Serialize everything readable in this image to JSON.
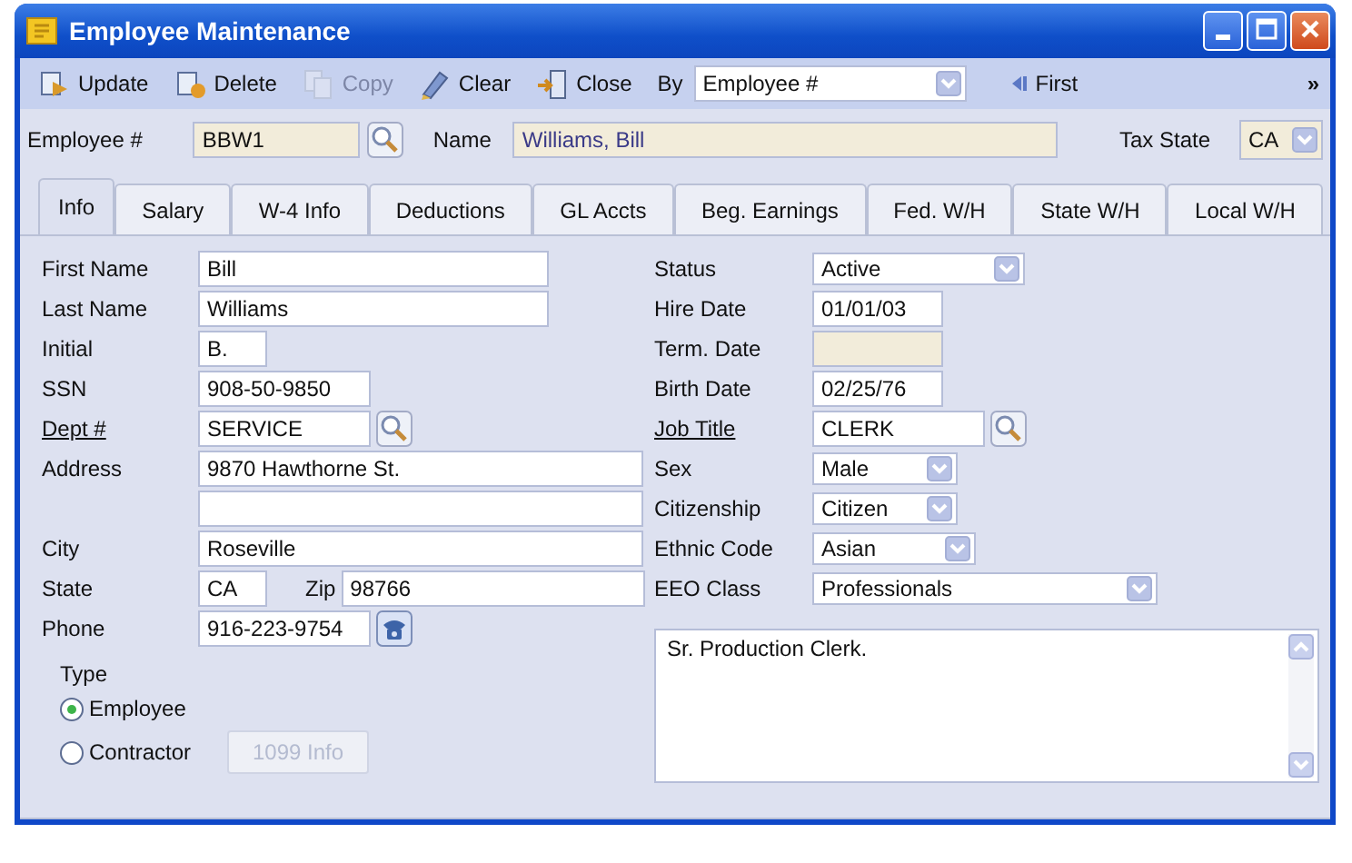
{
  "window": {
    "title": "Employee Maintenance"
  },
  "toolbar": {
    "buttons": [
      {
        "label": "Update",
        "disabled": false
      },
      {
        "label": "Delete",
        "disabled": false
      },
      {
        "label": "Copy",
        "disabled": true
      },
      {
        "label": "Clear",
        "disabled": false
      },
      {
        "label": "Close",
        "disabled": false
      }
    ],
    "by_label": "By",
    "by_value": "Employee #",
    "first": "First",
    "overflow": "»"
  },
  "header": {
    "employee_label": "Employee #",
    "employee_value": "BBW1",
    "name_label": "Name",
    "name_value": "Williams, Bill",
    "tax_state_label": "Tax State",
    "tax_state_value": "CA"
  },
  "tabs": [
    {
      "label": "Info",
      "selected": true
    },
    {
      "label": "Salary",
      "selected": false
    },
    {
      "label": "W-4 Info",
      "selected": false
    },
    {
      "label": "Deductions",
      "selected": false
    },
    {
      "label": "GL Accts",
      "selected": false
    },
    {
      "label": "Beg. Earnings",
      "selected": false
    },
    {
      "label": "Fed. W/H",
      "selected": false
    },
    {
      "label": "State W/H",
      "selected": false
    },
    {
      "label": "Local W/H",
      "selected": false
    }
  ],
  "left_fields": [
    {
      "kind": "text",
      "label": "First Name",
      "value": "Bill"
    },
    {
      "kind": "text",
      "label": "Last Name",
      "value": "Williams"
    },
    {
      "kind": "text",
      "label": "Initial",
      "value": "B."
    },
    {
      "kind": "text",
      "label": "SSN",
      "value": "908-50-9850"
    },
    {
      "kind": "lookup",
      "label": "Dept #",
      "value": "SERVICE",
      "link": true
    },
    {
      "kind": "text",
      "label": "Address",
      "value": "9870 Hawthorne St."
    },
    {
      "kind": "text"
    },
    {
      "kind": "text",
      "label": "City",
      "value": "Roseville"
    },
    {
      "kind": "state_zip",
      "label": "State",
      "value": "CA",
      "zip_label": "Zip",
      "zip_value": "98766"
    },
    {
      "kind": "phone",
      "label": "Phone",
      "value": "916-223-9754"
    }
  ],
  "type_group": {
    "label": "Type",
    "options": [
      {
        "label": "Employee",
        "selected": true
      },
      {
        "label": "Contractor",
        "selected": false
      }
    ],
    "info_button": {
      "label": "1099 Info",
      "disabled": true
    }
  },
  "right_fields": [
    {
      "kind": "combo",
      "label": "Status",
      "value": "Active"
    },
    {
      "kind": "text",
      "label": "Hire Date",
      "value": "01/01/03"
    },
    {
      "kind": "text",
      "label": "Term. Date",
      "disabled": true
    },
    {
      "kind": "text",
      "label": "Birth Date",
      "value": "02/25/76"
    },
    {
      "kind": "lookup",
      "label": "Job Title",
      "value": "CLERK",
      "link": true
    },
    {
      "kind": "combo",
      "label": "Sex",
      "value": "Male"
    },
    {
      "kind": "combo",
      "label": "Citizenship",
      "value": "Citizen"
    },
    {
      "kind": "combo",
      "label": "Ethnic Code",
      "value": "Asian"
    },
    {
      "kind": "combo",
      "label": "EEO Class",
      "value": "Professionals"
    }
  ],
  "notes": {
    "value": "Sr. Production Clerk."
  }
}
